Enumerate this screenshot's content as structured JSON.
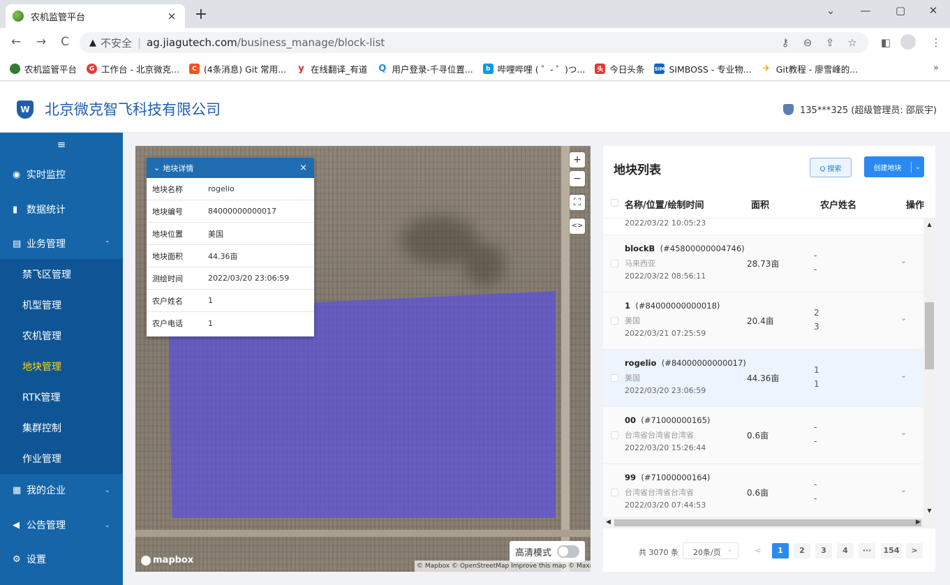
{
  "browser": {
    "tab_title": "农机监管平台",
    "tab_close": "×",
    "new_tab": "+",
    "win_min": "—",
    "win_max": "▢",
    "win_close": "✕",
    "win_menu": "⌄",
    "back": "←",
    "forward": "→",
    "reload": "C",
    "warn_icon": "▲",
    "insecure": "不安全",
    "sep": "|",
    "url_host": "ag.jiagutech.com",
    "url_path": "/business_manage/block-list",
    "bookmarks": [
      {
        "label": "农机监管平台",
        "color": "#2e7d32",
        "glyph": ""
      },
      {
        "label": "工作台 - 北京微克...",
        "color": "#e53935",
        "glyph": "G"
      },
      {
        "label": "(4条消息) Git 常用...",
        "color": "#f4511e",
        "glyph": "C"
      },
      {
        "label": "在线翻译_有道",
        "color": "#d32f2f",
        "glyph": "y"
      },
      {
        "label": "用户登录-千寻位置...",
        "color": "#1e88e5",
        "glyph": "Q"
      },
      {
        "label": "哔哩哔哩 ( ゜- ゜)つ...",
        "color": "#039be5",
        "glyph": "b"
      },
      {
        "label": "今日头条",
        "color": "#e53935",
        "glyph": "头"
      },
      {
        "label": "SIMBOSS - 专业物...",
        "color": "#1565c0",
        "glyph": "SIM"
      },
      {
        "label": "Git教程 - 廖雪峰的...",
        "color": "#ffa000",
        "glyph": "✈"
      }
    ],
    "bookmarks_more": "»"
  },
  "header": {
    "logo": "W",
    "company": "北京微克智飞科技有限公司",
    "user": "135***325 (超级管理员: 邵辰宇)"
  },
  "sidebar": {
    "toggle": "≡",
    "items": [
      {
        "icon": "◉",
        "label": "实时监控"
      },
      {
        "icon": "▮",
        "label": "数据统计"
      },
      {
        "icon": "▤",
        "label": "业务管理",
        "chev": "⌃"
      },
      {
        "icon": "▦",
        "label": "我的企业",
        "chev": "⌄"
      },
      {
        "icon": "◀",
        "label": "公告管理",
        "chev": "⌄"
      },
      {
        "icon": "⚙",
        "label": "设置"
      }
    ],
    "sub_items": [
      "禁飞区管理",
      "机型管理",
      "农机管理",
      "地块管理",
      "RTK管理",
      "集群控制",
      "作业管理"
    ]
  },
  "map": {
    "zoom_in": "+",
    "zoom_out": "−",
    "fullscreen": "⛶",
    "code": "<>",
    "mapbox": "mapbox",
    "attribution": "© Mapbox © OpenStreetMap Improve this map © Maxar",
    "hd_mode": "高清模式",
    "card": {
      "title": "地块详情",
      "collapse": "⌄",
      "close": "×",
      "fields": [
        {
          "k": "地块名称",
          "v": "rogelio"
        },
        {
          "k": "地块编号",
          "v": "84000000000017"
        },
        {
          "k": "地块位置",
          "v": "美国"
        },
        {
          "k": "地块面积",
          "v": "44.36亩"
        },
        {
          "k": "测绘时间",
          "v": "2022/03/20 23:06:59"
        },
        {
          "k": "农户姓名",
          "v": "1"
        },
        {
          "k": "农户电话",
          "v": "1"
        }
      ]
    }
  },
  "list": {
    "title": "地块列表",
    "search_btn": "Q 搜索",
    "create_btn": "创建地块",
    "create_dd": "⌄",
    "headers": {
      "name": "名称/位置/绘制时间",
      "area": "面积",
      "farmer": "农户姓名",
      "op": "操作"
    },
    "prev_time": "2022/03/22 10:05:23",
    "rows": [
      {
        "name": "blockB",
        "code": "(#45800000004746)",
        "loc": "马来西亚",
        "time": "2022/03/22 08:56:11",
        "area": "28.73亩",
        "f1": "-",
        "f2": "-",
        "op": "⌄"
      },
      {
        "name": "1",
        "code": "(#84000000000018)",
        "loc": "美国",
        "time": "2022/03/21 07:25:59",
        "area": "20.4亩",
        "f1": "2",
        "f2": "3",
        "op": "⌄"
      },
      {
        "name": "rogelio",
        "code": "(#84000000000017)",
        "loc": "美国",
        "time": "2022/03/20 23:06:59",
        "area": "44.36亩",
        "f1": "1",
        "f2": "1",
        "op": "⌄"
      },
      {
        "name": "00",
        "code": "(#71000000165)",
        "loc": "台湾省台湾省台湾省",
        "time": "2022/03/20 15:26:44",
        "area": "0.6亩",
        "f1": "-",
        "f2": "-",
        "op": "⌄"
      },
      {
        "name": "99",
        "code": "(#71000000164)",
        "loc": "台湾省台湾省台湾省",
        "time": "2022/03/20 07:44:53",
        "area": "0.6亩",
        "f1": "-",
        "f2": "-",
        "op": "⌄"
      }
    ],
    "scroll_up": "▲",
    "scroll_down": "▼",
    "scroll_left": "◀",
    "scroll_right": "▶",
    "pager": {
      "total": "共 3070 条",
      "size": "20条/页",
      "size_arrow": "⌄",
      "prev": "<",
      "pages": [
        "1",
        "2",
        "3",
        "4",
        "···",
        "154"
      ],
      "next": ">"
    }
  }
}
